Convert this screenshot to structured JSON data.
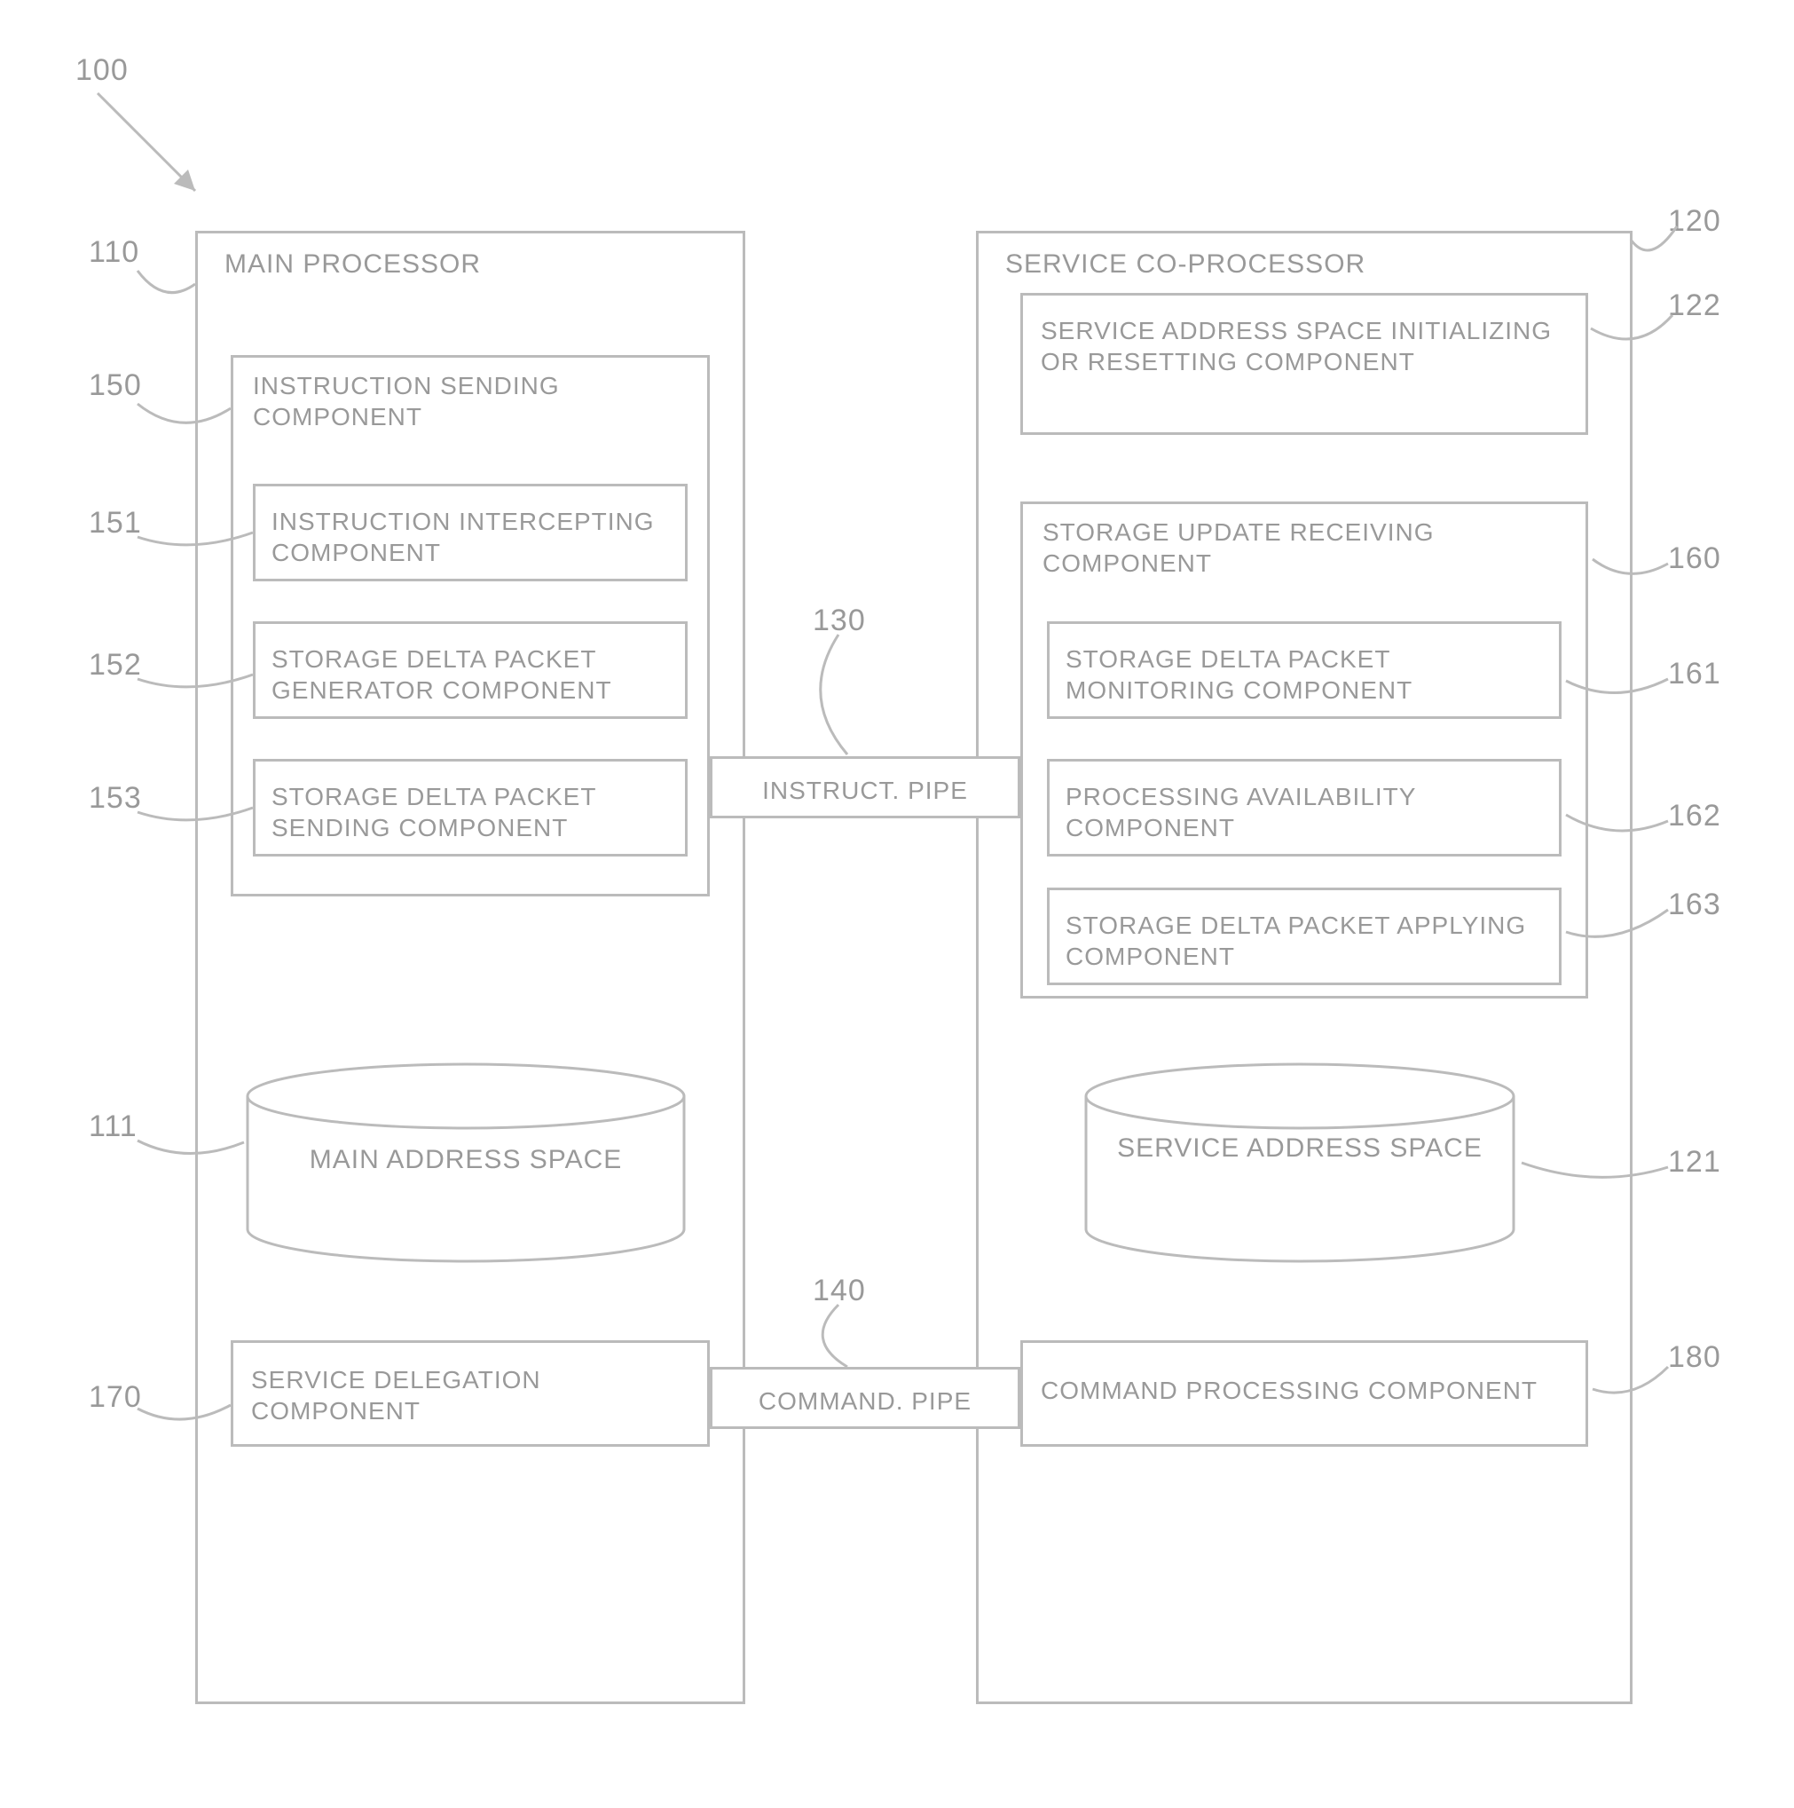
{
  "refs": {
    "r100": "100",
    "r110": "110",
    "r120": "120",
    "r150": "150",
    "r151": "151",
    "r152": "152",
    "r153": "153",
    "r130": "130",
    "r111": "111",
    "r140": "140",
    "r170": "170",
    "r122": "122",
    "r160": "160",
    "r161": "161",
    "r162": "162",
    "r163": "163",
    "r121": "121",
    "r180": "180"
  },
  "main_processor": {
    "title": "MAIN PROCESSOR",
    "instruction_sending": {
      "title": "INSTRUCTION SENDING COMPONENT",
      "sub1": "INSTRUCTION INTERCEPTING COMPONENT",
      "sub2": "STORAGE DELTA PACKET GENERATOR COMPONENT",
      "sub3": "STORAGE DELTA PACKET SENDING COMPONENT"
    },
    "address_space": "MAIN ADDRESS SPACE",
    "service_delegation": "SERVICE DELEGATION COMPONENT"
  },
  "service_coprocessor": {
    "title": "SERVICE CO-PROCESSOR",
    "init_component": "SERVICE ADDRESS SPACE INITIALIZING OR RESETTING COMPONENT",
    "storage_update": {
      "title": "STORAGE UPDATE RECEIVING COMPONENT",
      "sub1": "STORAGE DELTA PACKET MONITORING COMPONENT",
      "sub2": "PROCESSING AVAILABILITY COMPONENT",
      "sub3": "STORAGE DELTA PACKET APPLYING COMPONENT"
    },
    "address_space": "SERVICE ADDRESS SPACE",
    "command_processing": "COMMAND PROCESSING COMPONENT"
  },
  "pipes": {
    "instruct": "INSTRUCT. PIPE",
    "command": "COMMAND. PIPE"
  }
}
